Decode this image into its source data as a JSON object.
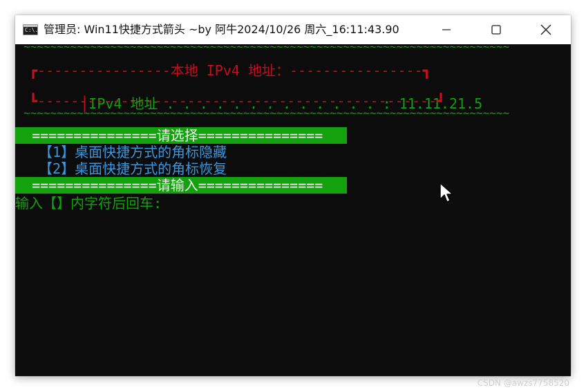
{
  "window": {
    "icon_label": "C:\\.",
    "title": "管理员:  Win11快捷方式箭头 ~by 阿牛2024/10/26 周六_16:11:43.90",
    "minimize_label": "minimize",
    "maximize_label": "maximize",
    "close_label": "close"
  },
  "console": {
    "tilde_line_1": "~~~~~~~~~~~~~~~~~~~~~~~~~~~~~~~~~~~~~~~~~~~~~~~~~~~~~~~~~~~~~~~~~~~~~~~~~",
    "ip_box_top": "┏----------------本地 IPv4 地址：----------------┓",
    "ip_line_label": "IPv4 地址 . . . . . . . . . . . . . :",
    "ip_value": "11.11.21.5",
    "ip_box_bottom": "┗------------------------------------------------┛",
    "tilde_line_2": "~~~~~~~~~~~~~~~~~~~~~~~~~~~~~~~~~~~~~~~~~~~~~~~~~~~~~~~~~~~~~~~~~~~~~~~~~",
    "select_bar": "  ===============请选择===============",
    "option_1": " 【1】桌面快捷方式的角标隐藏",
    "option_2": " 【2】桌面快捷方式的角标恢复",
    "input_bar": "  ===============请输入===============",
    "prompt": "输入【】内字符后回车:"
  },
  "watermark": "CSDN @awzs7758520",
  "colors": {
    "console_bg": "#0c0c0c",
    "green": "#13a10e",
    "red": "#c50f1f",
    "cyan": "#3a96dd"
  }
}
